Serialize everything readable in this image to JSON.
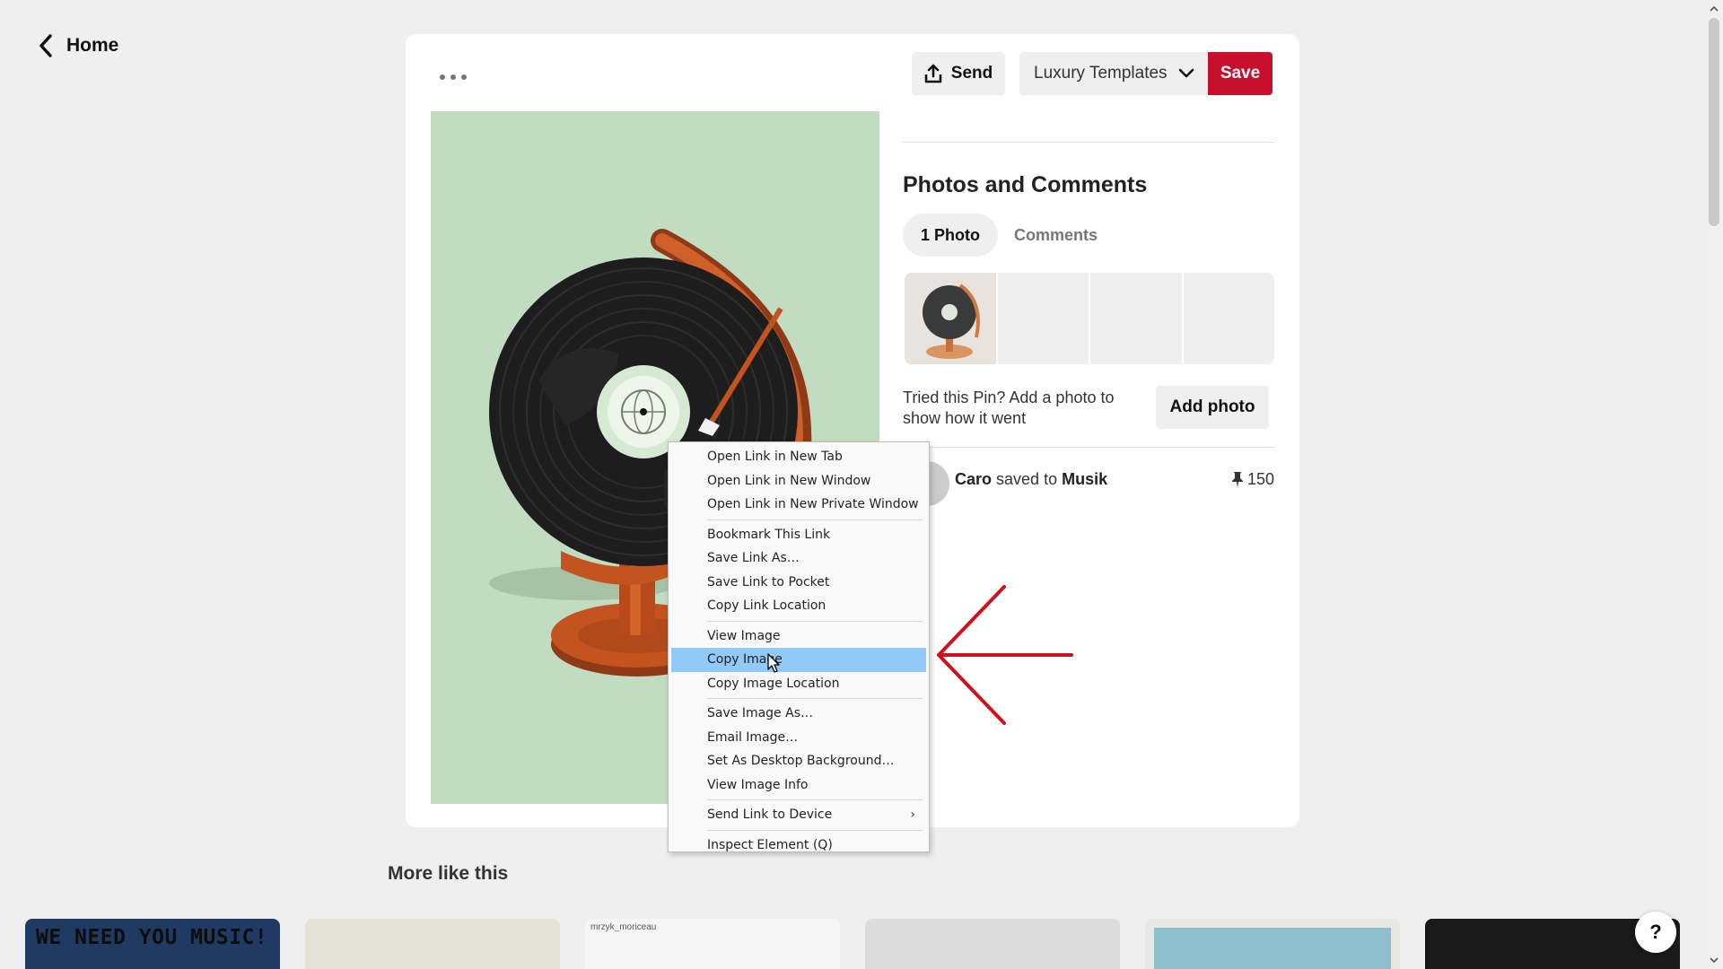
{
  "nav": {
    "home_label": "Home"
  },
  "actions": {
    "send_label": "Send",
    "board_name": "Luxury Templates",
    "save_label": "Save"
  },
  "section": {
    "title": "Photos and Comments",
    "tab_photo": "1 Photo",
    "tab_comments": "Comments"
  },
  "tried": {
    "text": "Tried this Pin? Add a photo to show how it went",
    "button": "Add photo"
  },
  "saver": {
    "user": "Caro",
    "middle": "saved to",
    "board": "Musik",
    "count": "150"
  },
  "more": {
    "title": "More like this",
    "tile1_text": "WE NEED YOU MUSIC!",
    "tile3_user": "mrzyk_moriceau"
  },
  "help": {
    "label": "?"
  },
  "context_menu": {
    "items": [
      "Open Link in New Tab",
      "Open Link in New Window",
      "Open Link in New Private Window",
      "Bookmark This Link",
      "Save Link As…",
      "Save Link to Pocket",
      "Copy Link Location",
      "View Image",
      "Copy Image",
      "Copy Image Location",
      "Save Image As…",
      "Email Image…",
      "Set As Desktop Background…",
      "View Image Info",
      "Send Link to Device",
      "Inspect Element (Q)"
    ],
    "highlighted": "Copy Image"
  },
  "colors": {
    "save_red": "#c8102e",
    "highlight": "#91c9f7",
    "arrow_red": "#d0101a",
    "image_bg": "#c1dcc1"
  }
}
